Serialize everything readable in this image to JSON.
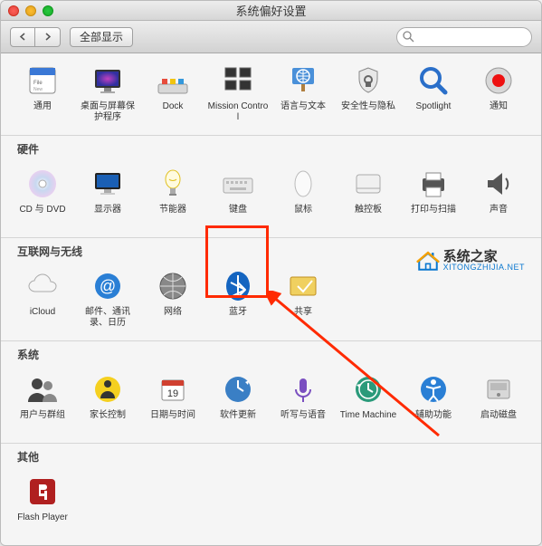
{
  "window": {
    "title": "系统偏好设置"
  },
  "toolbar": {
    "show_all": "全部显示",
    "search_placeholder": ""
  },
  "sections": {
    "row1": [
      {
        "id": "general",
        "label": "通用"
      },
      {
        "id": "desktop",
        "label": "桌面与屏幕保护程序"
      },
      {
        "id": "dock",
        "label": "Dock"
      },
      {
        "id": "mission",
        "label": "Mission Control"
      },
      {
        "id": "language",
        "label": "语言与文本"
      },
      {
        "id": "security",
        "label": "安全性与隐私"
      },
      {
        "id": "spotlight",
        "label": "Spotlight"
      },
      {
        "id": "notifications",
        "label": "通知"
      }
    ],
    "hardware_title": "硬件",
    "hardware": [
      {
        "id": "cddvd",
        "label": "CD 与 DVD"
      },
      {
        "id": "displays",
        "label": "显示器"
      },
      {
        "id": "energy",
        "label": "节能器"
      },
      {
        "id": "keyboard",
        "label": "键盘"
      },
      {
        "id": "mouse",
        "label": "鼠标"
      },
      {
        "id": "trackpad",
        "label": "触控板"
      },
      {
        "id": "print",
        "label": "打印与扫描"
      },
      {
        "id": "sound",
        "label": "声音"
      }
    ],
    "internet_title": "互联网与无线",
    "internet": [
      {
        "id": "icloud",
        "label": "iCloud"
      },
      {
        "id": "mail",
        "label": "邮件、通讯录、日历"
      },
      {
        "id": "network",
        "label": "网络"
      },
      {
        "id": "bluetooth",
        "label": "蓝牙"
      },
      {
        "id": "sharing",
        "label": "共享"
      }
    ],
    "system_title": "系统",
    "system": [
      {
        "id": "users",
        "label": "用户与群组"
      },
      {
        "id": "parental",
        "label": "家长控制"
      },
      {
        "id": "datetime",
        "label": "日期与时间"
      },
      {
        "id": "update",
        "label": "软件更新"
      },
      {
        "id": "dictation",
        "label": "听写与语音"
      },
      {
        "id": "timemachine",
        "label": "Time Machine"
      },
      {
        "id": "accessibility",
        "label": "辅助功能"
      },
      {
        "id": "startup",
        "label": "启动磁盘"
      }
    ],
    "other_title": "其他",
    "other": [
      {
        "id": "flash",
        "label": "Flash Player"
      }
    ]
  },
  "watermark": {
    "cn": "系统之家",
    "en": "XITONGZHIJIA.NET"
  }
}
